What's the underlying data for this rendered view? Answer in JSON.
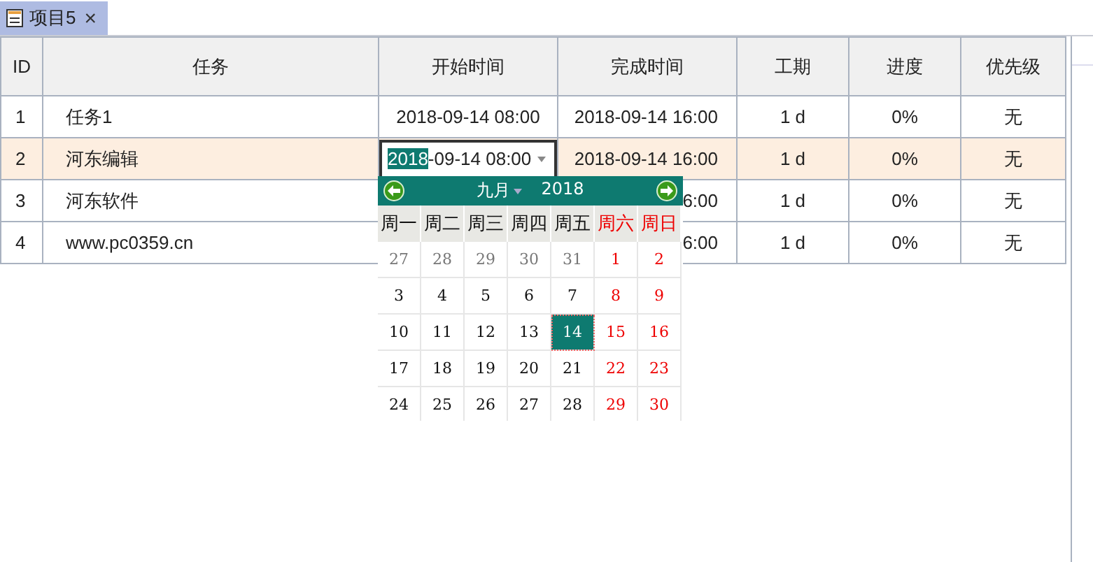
{
  "tab": {
    "label": "项目5",
    "close": "×"
  },
  "table": {
    "columns": [
      "ID",
      "任务",
      "开始时间",
      "完成时间",
      "工期",
      "进度",
      "优先级"
    ],
    "rows": [
      {
        "id": "1",
        "task": "任务1",
        "start": "2018-09-14 08:00",
        "end": "2018-09-14 16:00",
        "duration": "1 d",
        "progress": "0%",
        "priority": "无",
        "selected": false,
        "editing": false
      },
      {
        "id": "2",
        "task": "河东编辑",
        "start_selected": "2018",
        "start_rest": "-09-14 08:00",
        "end": "2018-09-14 16:00",
        "duration": "1 d",
        "progress": "0%",
        "priority": "无",
        "selected": true,
        "editing": true
      },
      {
        "id": "3",
        "task": "河东软件",
        "end": "6:00",
        "duration": "1 d",
        "progress": "0%",
        "priority": "无",
        "selected": false,
        "editing": false
      },
      {
        "id": "4",
        "task": "www.pc0359.cn",
        "end": "6:00",
        "duration": "1 d",
        "progress": "0%",
        "priority": "无",
        "selected": false,
        "editing": false
      }
    ]
  },
  "date_picker": {
    "month": "九月",
    "year": "2018",
    "weekdays": [
      {
        "label": "周一",
        "weekend": false
      },
      {
        "label": "周二",
        "weekend": false
      },
      {
        "label": "周三",
        "weekend": false
      },
      {
        "label": "周四",
        "weekend": false
      },
      {
        "label": "周五",
        "weekend": false
      },
      {
        "label": "周六",
        "weekend": true
      },
      {
        "label": "周日",
        "weekend": true
      }
    ],
    "weeks": [
      [
        {
          "d": "27",
          "kind": "other",
          "selected": false
        },
        {
          "d": "28",
          "kind": "other",
          "selected": false
        },
        {
          "d": "29",
          "kind": "other",
          "selected": false
        },
        {
          "d": "30",
          "kind": "other",
          "selected": false
        },
        {
          "d": "31",
          "kind": "other",
          "selected": false
        },
        {
          "d": "1",
          "kind": "weekend",
          "selected": false
        },
        {
          "d": "2",
          "kind": "weekend",
          "selected": false
        }
      ],
      [
        {
          "d": "3",
          "kind": "normal",
          "selected": false
        },
        {
          "d": "4",
          "kind": "normal",
          "selected": false
        },
        {
          "d": "5",
          "kind": "normal",
          "selected": false
        },
        {
          "d": "6",
          "kind": "normal",
          "selected": false
        },
        {
          "d": "7",
          "kind": "normal",
          "selected": false
        },
        {
          "d": "8",
          "kind": "weekend",
          "selected": false
        },
        {
          "d": "9",
          "kind": "weekend",
          "selected": false
        }
      ],
      [
        {
          "d": "10",
          "kind": "normal",
          "selected": false
        },
        {
          "d": "11",
          "kind": "normal",
          "selected": false
        },
        {
          "d": "12",
          "kind": "normal",
          "selected": false
        },
        {
          "d": "13",
          "kind": "normal",
          "selected": false
        },
        {
          "d": "14",
          "kind": "normal",
          "selected": true
        },
        {
          "d": "15",
          "kind": "weekend",
          "selected": false
        },
        {
          "d": "16",
          "kind": "weekend",
          "selected": false
        }
      ],
      [
        {
          "d": "17",
          "kind": "normal",
          "selected": false
        },
        {
          "d": "18",
          "kind": "normal",
          "selected": false
        },
        {
          "d": "19",
          "kind": "normal",
          "selected": false
        },
        {
          "d": "20",
          "kind": "normal",
          "selected": false
        },
        {
          "d": "21",
          "kind": "normal",
          "selected": false
        },
        {
          "d": "22",
          "kind": "weekend",
          "selected": false
        },
        {
          "d": "23",
          "kind": "weekend",
          "selected": false
        }
      ],
      [
        {
          "d": "24",
          "kind": "normal",
          "selected": false
        },
        {
          "d": "25",
          "kind": "normal",
          "selected": false
        },
        {
          "d": "26",
          "kind": "normal",
          "selected": false
        },
        {
          "d": "27",
          "kind": "normal",
          "selected": false
        },
        {
          "d": "28",
          "kind": "normal",
          "selected": false
        },
        {
          "d": "29",
          "kind": "weekend",
          "selected": false
        },
        {
          "d": "30",
          "kind": "weekend",
          "selected": false
        }
      ]
    ]
  }
}
